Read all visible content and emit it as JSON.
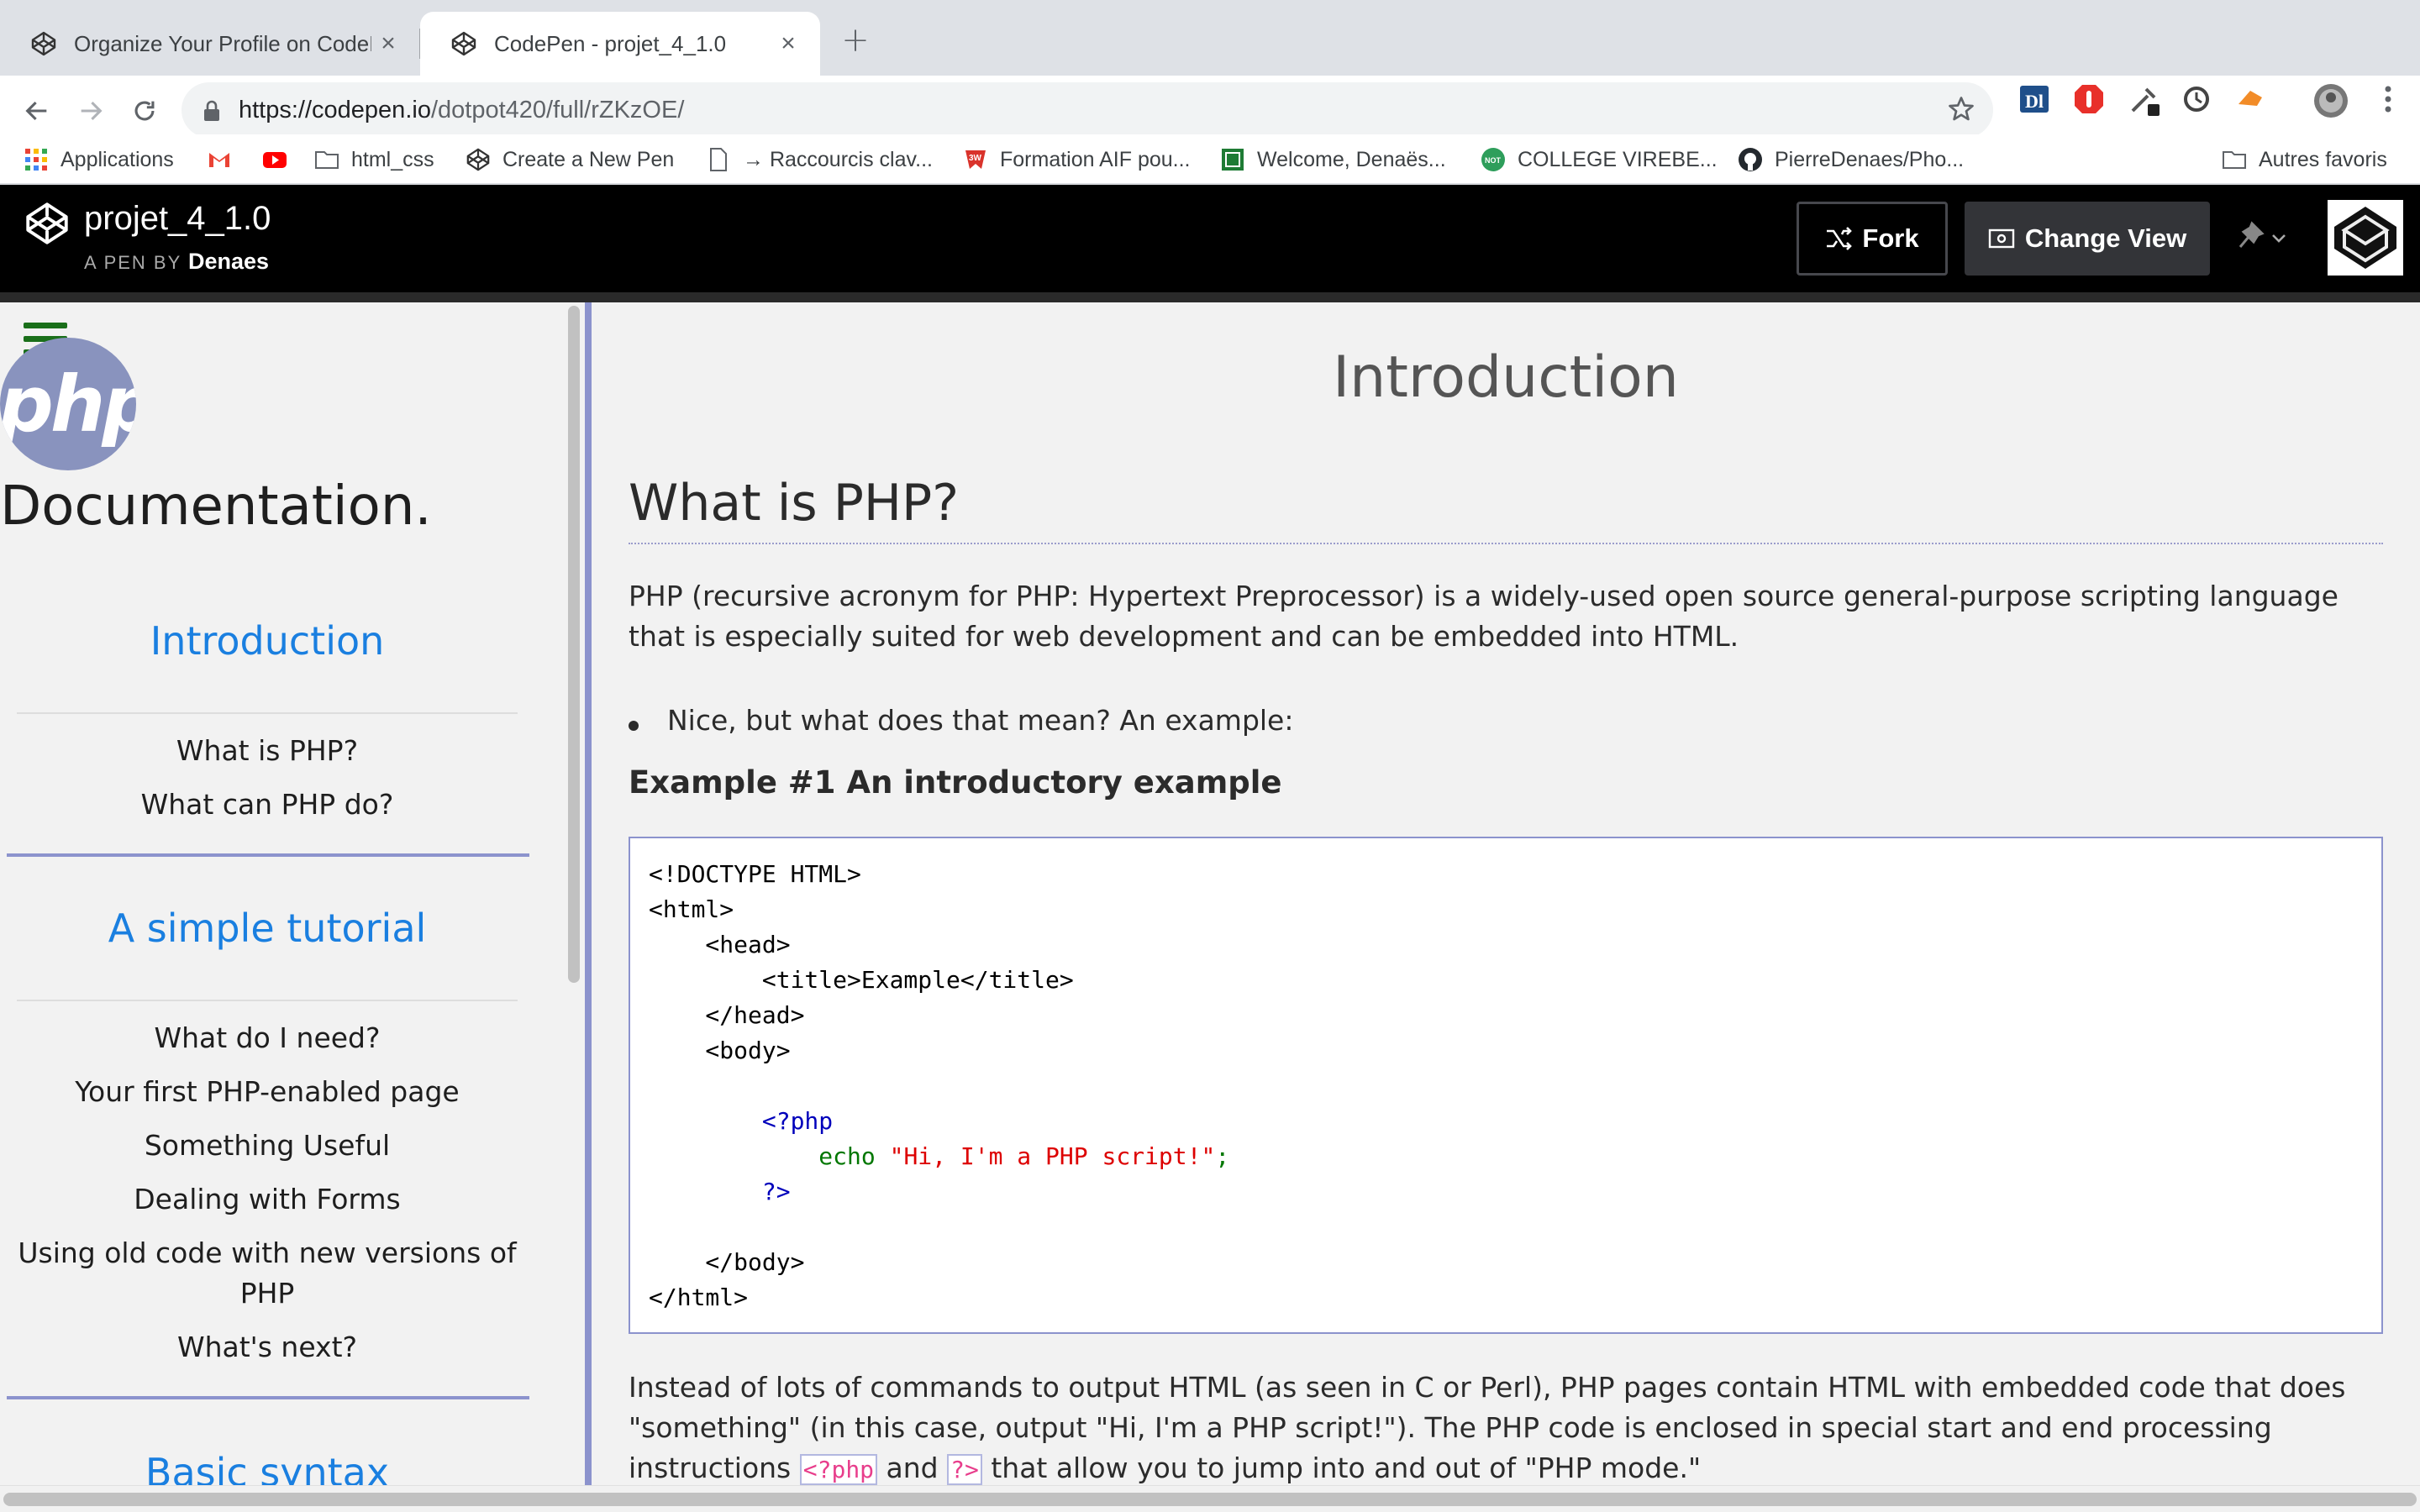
{
  "browser": {
    "tabs": [
      {
        "title": "Organize Your Profile on CodePen",
        "active": false
      },
      {
        "title": "CodePen - projet_4_1.0",
        "active": true
      }
    ],
    "new_tab_label": "+",
    "url_host": "https://codepen.io",
    "url_path": "/dotpot420/full/rZKzOE/",
    "bookmarks": [
      {
        "label": "Applications",
        "icon": "apps-grid-icon"
      },
      {
        "label": "",
        "icon": "gmail-icon"
      },
      {
        "label": "",
        "icon": "youtube-icon"
      },
      {
        "label": "html_css",
        "icon": "folder-icon"
      },
      {
        "label": "Create a New Pen",
        "icon": "codepen-icon"
      },
      {
        "label": "→ Raccourcis clav...",
        "icon": "page-icon"
      },
      {
        "label": "Formation AIF pou...",
        "icon": "3w-icon"
      },
      {
        "label": "Welcome, Denaës...",
        "icon": "green-badge-icon"
      },
      {
        "label": "COLLEGE VIREBE...",
        "icon": "not-badge-icon"
      },
      {
        "label": "PierreDenaes/Pho...",
        "icon": "github-icon"
      },
      {
        "label": "Autres favoris",
        "icon": "folder-icon"
      }
    ],
    "extensions": [
      "dp-extension-icon",
      "adblock-extension-icon",
      "eyedropper-extension-icon",
      "sync-extension-icon",
      "orange-extension-icon",
      "profile-avatar-icon",
      "menu-dots-icon"
    ]
  },
  "codepen": {
    "pen_title": "projet_4_1.0",
    "pen_by_prefix": "A PEN BY",
    "author": "Denaes",
    "fork_label": "Fork",
    "change_view_label": "Change View"
  },
  "sidebar": {
    "doc_title": "Documentation.",
    "logo_text": "php",
    "sections": [
      {
        "heading": "Introduction",
        "links": [
          "What is PHP?",
          "What can PHP do?"
        ]
      },
      {
        "heading": "A simple tutorial",
        "links": [
          "What do I need?",
          "Your first PHP-enabled page",
          "Something Useful",
          "Dealing with Forms",
          "Using old code with new versions of PHP",
          "What's next?"
        ]
      },
      {
        "heading": "Basic syntax",
        "links": []
      }
    ]
  },
  "main": {
    "section_title": "Introduction",
    "h2": "What is PHP?",
    "para1": "PHP (recursive acronym for PHP: Hypertext Preprocessor) is a widely-used open source general-purpose scripting language that is especially suited for web development and can be embedded into HTML.",
    "bullet": "Nice, but what does that mean? An example:",
    "example_title": "Example #1 An introductory example",
    "code": {
      "l1": "<!DOCTYPE HTML>",
      "l2": "<html>",
      "l3": "    <head>",
      "l4": "        <title>Example</title>",
      "l5": "    </head>",
      "l6": "    <body>",
      "l7": "",
      "l8_open": "        <?php",
      "l9_indent": "            ",
      "l9_fn": "echo",
      "l9_str": "\"Hi, I'm a PHP script!\"",
      "l9_end": ";",
      "l10_close": "        ?>",
      "l11": "",
      "l12": "    </body>",
      "l13": "</html>"
    },
    "para2_a": "Instead of lots of commands to output HTML (as seen in C or Perl), PHP pages contain HTML with embedded code that does \"something\" (in this case, output \"Hi, I'm a PHP script!\"). The PHP code is enclosed in special start and end processing instructions ",
    "para2_code1": "<?php",
    "para2_b": " and ",
    "para2_code2": "?>",
    "para2_c": " that allow you to jump into and out of \"PHP mode.\""
  },
  "colors": {
    "accent_link": "#1a7fe0",
    "border_accent": "#8c93cd",
    "php_logo": "#8993be",
    "hamburger": "#1a6f1a"
  }
}
